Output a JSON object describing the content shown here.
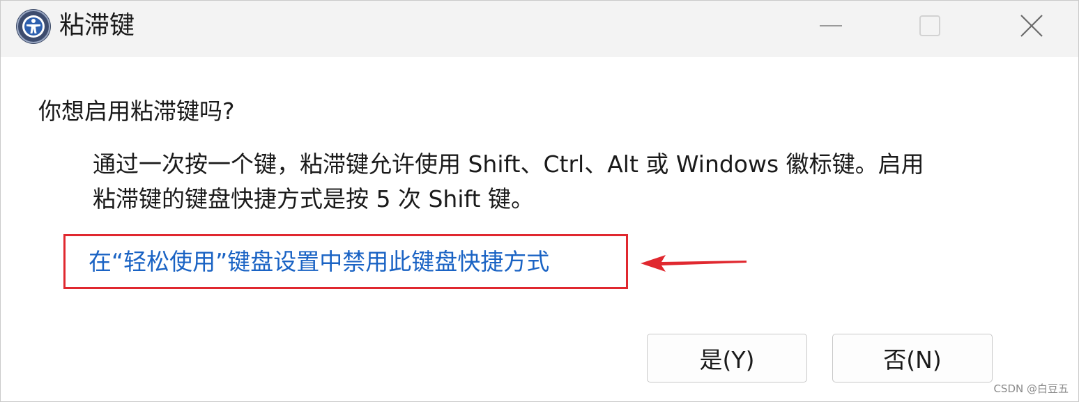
{
  "window": {
    "title": "粘滞键",
    "icon": "accessibility-icon",
    "controls": {
      "minimize_icon": "minimize-icon",
      "maximize_icon": "maximize-icon",
      "close_icon": "close-icon"
    }
  },
  "content": {
    "question": "你想启用粘滞键吗?",
    "description_line1": "通过一次按一个键，粘滞键允许使用 Shift、Ctrl、Alt 或 Windows 徽标键。启用",
    "description_line2": "粘滞键的键盘快捷方式是按 5 次 Shift 键。",
    "link_text": "在“轻松使用”键盘设置中禁用此键盘快捷方式"
  },
  "buttons": {
    "yes_label": "是(Y)",
    "no_label": "否(N)"
  },
  "annotation": {
    "highlight_color": "#e0282f",
    "arrow_icon": "arrow-left-icon"
  },
  "watermark": "CSDN @白豆五",
  "colors": {
    "titlebar_bg": "#f3f3f3",
    "link": "#1a63c4",
    "annotation_red": "#e0282f"
  }
}
